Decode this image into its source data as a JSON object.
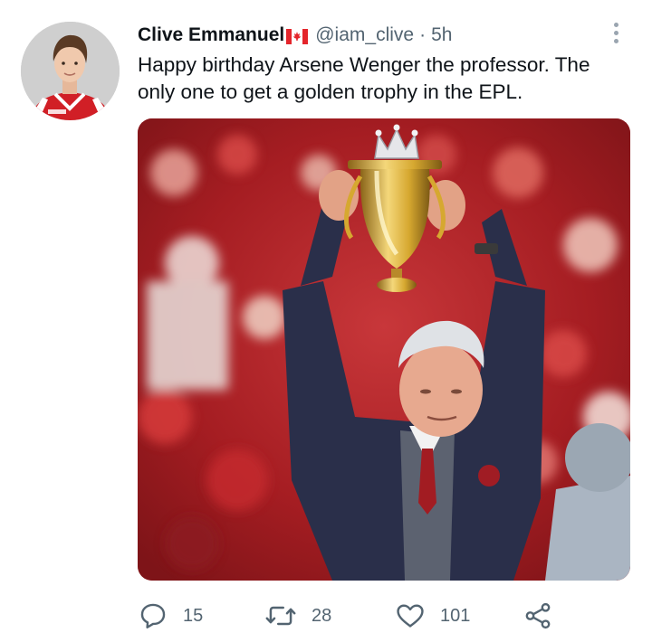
{
  "tweet": {
    "display_name": "Clive Emmanuel",
    "flag_icon": "canada-flag-icon",
    "handle": "@iam_clive",
    "separator": "·",
    "time": "5h",
    "text": "Happy birthday Arsene Wenger the professor. The only one to get a golden trophy in the EPL.",
    "avatar_icon": "avatar",
    "media_alt": "Man in dark blazer holding a golden crowned trophy above his head in a red stadium crowd"
  },
  "actions": {
    "reply": {
      "icon": "reply-icon",
      "count": "15"
    },
    "retweet": {
      "icon": "retweet-icon",
      "count": "28"
    },
    "like": {
      "icon": "heart-icon",
      "count": "101"
    },
    "share": {
      "icon": "share-icon"
    }
  },
  "colors": {
    "text": "#0f1419",
    "secondary": "#536471",
    "flag_red": "#e4252b",
    "crowd_red": "#b32025",
    "trophy_gold": "#d6a830"
  }
}
